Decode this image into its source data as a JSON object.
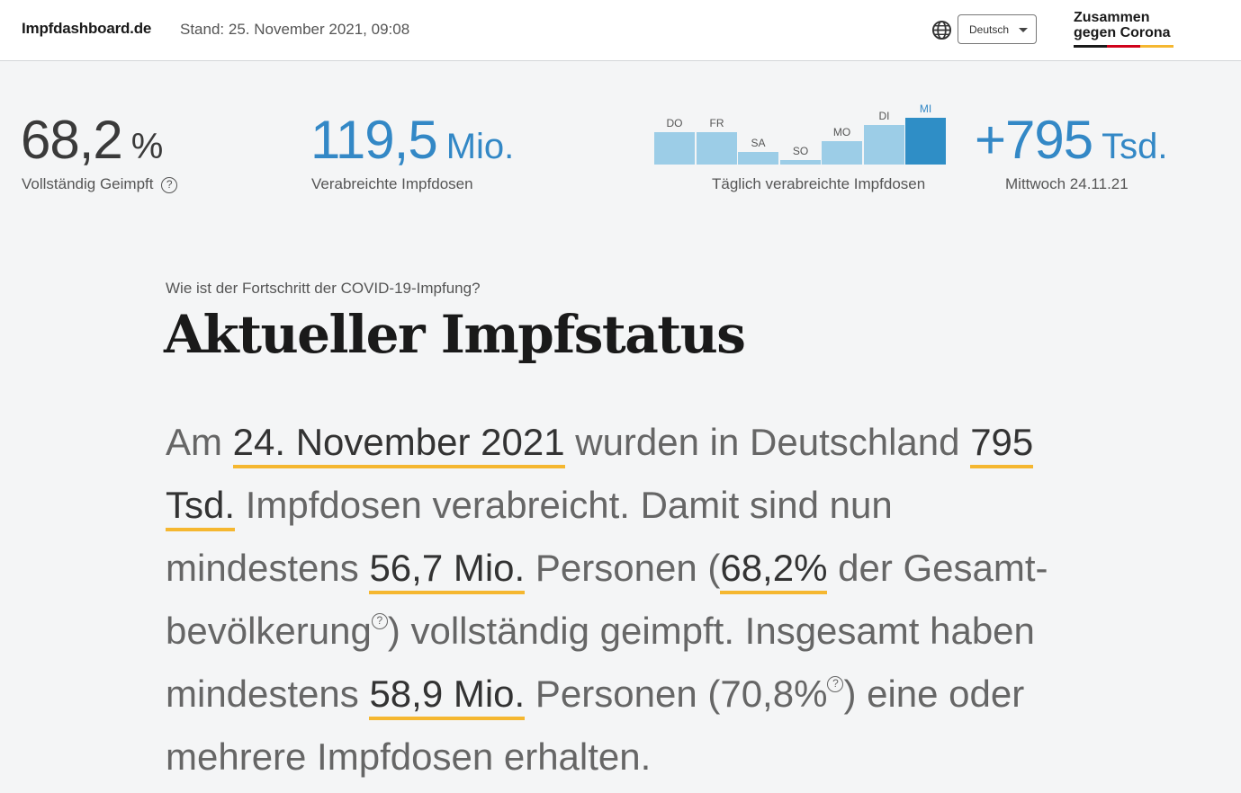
{
  "header": {
    "brand": "Impfdashboard.de",
    "stand": "Stand: 25. November 2021, 09:08",
    "language": "Deutsch",
    "logo_line1": "Zusammen",
    "logo_line2": "gegen Corona"
  },
  "kpis": {
    "vollstaendig": {
      "value": "68,2",
      "unit": "%",
      "label": "Vollständig Geimpft",
      "help": "?"
    },
    "dosen": {
      "value": "119,5",
      "unit": "Mio.",
      "label": "Verabreichte Impfdosen"
    },
    "taeglich": {
      "label": "Täglich verabreichte Impfdosen"
    },
    "mittwoch": {
      "value": "+795",
      "unit": "Tsd.",
      "label": "Mittwoch 24.11.21"
    }
  },
  "chart_data": {
    "type": "bar",
    "categories": [
      "DO",
      "FR",
      "SA",
      "SO",
      "MO",
      "DI",
      "MI"
    ],
    "values": [
      0.7,
      0.7,
      0.26,
      0.1,
      0.5,
      0.85,
      1.0
    ],
    "highlight_index": 6
  },
  "main": {
    "kicker": "Wie ist der Fortschritt der COVID-19-Impfung?",
    "title": "Aktueller Impfstatus",
    "p_am": "Am ",
    "p_date": "24. November 2021",
    "p_wurden": " wurden in Deutschland ",
    "p_tsd": "795 Tsd.",
    "p_impf": " Impfdosen verabreicht. Damit sind nun mindestens ",
    "p_mio1": "56,7 Mio.",
    "p_pers1": " Personen (",
    "p_pct1": "68,2%",
    "p_ges": " der Gesamt-bevölkerung",
    "p_voll": ") vollständig geimpft. Insgesamt haben mindestens ",
    "p_mio2": "58,9 Mio.",
    "p_pers2": " Personen (70,8%",
    "p_end": ") eine oder mehrere Impfdosen erhalten.",
    "help": "?"
  },
  "colors": {
    "accent": "#3388c6",
    "bar": "#9ccde7",
    "bar_highlight": "#2f8ec6",
    "underline": "#f5b730"
  }
}
